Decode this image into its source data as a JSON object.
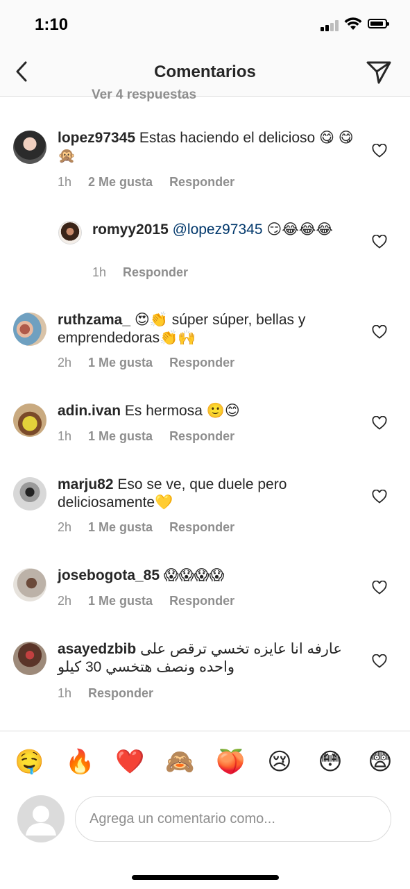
{
  "status": {
    "time": "1:10"
  },
  "header": {
    "title": "Comentarios"
  },
  "partial_reply": {
    "text": "Ver 4 respuestas"
  },
  "comments": [
    {
      "user": "lopez97345",
      "text": " Estas haciendo el delicioso 😋 😋 🙊",
      "time": "1h",
      "likes": "2 Me gusta",
      "reply": "Responder"
    },
    {
      "user": "romyy2015",
      "mention": " @lopez97345",
      "text": " 😏😂😂😂",
      "time": "1h",
      "reply": "Responder"
    },
    {
      "user": "ruthzama_",
      "text": " 😍👏 súper súper, bellas y emprendedoras👏🙌",
      "time": "2h",
      "likes": "1 Me gusta",
      "reply": "Responder"
    },
    {
      "user": "adin.ivan",
      "text": " Es hermosa 🙂😊",
      "time": "1h",
      "likes": "1 Me gusta",
      "reply": "Responder"
    },
    {
      "user": "marju82",
      "text": " Eso se ve, que duele pero deliciosamente💛",
      "time": "2h",
      "likes": "1 Me gusta",
      "reply": "Responder"
    },
    {
      "user": "josebogota_85",
      "text": " 😱😱😱😱",
      "time": "2h",
      "likes": "1 Me gusta",
      "reply": "Responder"
    },
    {
      "user": "asayedzbib",
      "text": " عارفه انا عايزه تخسي ترقص على واحده ونصف هتخسي 30 كيلو",
      "time": "1h",
      "reply": "Responder"
    }
  ],
  "emoji_bar": [
    "🤤",
    "🔥",
    "❤️",
    "🙈",
    "🍑",
    "😢",
    "😳",
    "😨"
  ],
  "composer": {
    "placeholder": "Agrega un comentario como..."
  }
}
